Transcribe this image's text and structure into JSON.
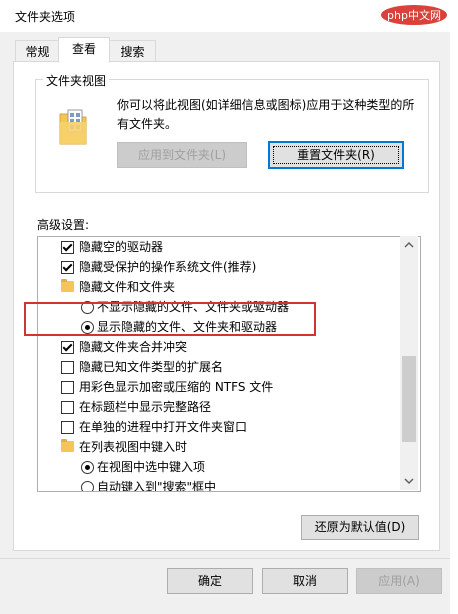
{
  "window": {
    "title": "文件夹选项"
  },
  "tabs": [
    {
      "label": "常规"
    },
    {
      "label": "查看"
    },
    {
      "label": "搜索"
    }
  ],
  "folder_views": {
    "title": "文件夹视图",
    "description": "你可以将此视图(如详细信息或图标)应用于这种类型的所有文件夹。",
    "apply_button": "应用到文件夹(L)",
    "reset_button": "重置文件夹(R)"
  },
  "advanced": {
    "label": "高级设置:",
    "items": [
      {
        "type": "checkbox",
        "checked": true,
        "label": "隐藏空的驱动器"
      },
      {
        "type": "checkbox",
        "checked": true,
        "label": "隐藏受保护的操作系统文件(推荐)"
      },
      {
        "type": "folder",
        "label": "隐藏文件和文件夹"
      },
      {
        "type": "radio",
        "checked": false,
        "label": "不显示隐藏的文件、文件夹或驱动器"
      },
      {
        "type": "radio",
        "checked": true,
        "label": "显示隐藏的文件、文件夹和驱动器"
      },
      {
        "type": "checkbox",
        "checked": true,
        "label": "隐藏文件夹合并冲突"
      },
      {
        "type": "checkbox",
        "checked": false,
        "label": "隐藏已知文件类型的扩展名"
      },
      {
        "type": "checkbox",
        "checked": false,
        "label": "用彩色显示加密或压缩的 NTFS 文件"
      },
      {
        "type": "checkbox",
        "checked": false,
        "label": "在标题栏中显示完整路径"
      },
      {
        "type": "checkbox",
        "checked": false,
        "label": "在单独的进程中打开文件夹窗口"
      },
      {
        "type": "folder",
        "label": "在列表视图中键入时"
      },
      {
        "type": "radio",
        "checked": true,
        "label": "在视图中选中键入项"
      },
      {
        "type": "radio",
        "checked": false,
        "label": "自动键入到\"搜索\"框中"
      }
    ],
    "restore_button": "还原为默认值(D)"
  },
  "footer": {
    "ok": "确定",
    "cancel": "取消",
    "apply": "应用(A)"
  },
  "logo": {
    "text": "php中文网",
    "color": "#d9413a"
  }
}
